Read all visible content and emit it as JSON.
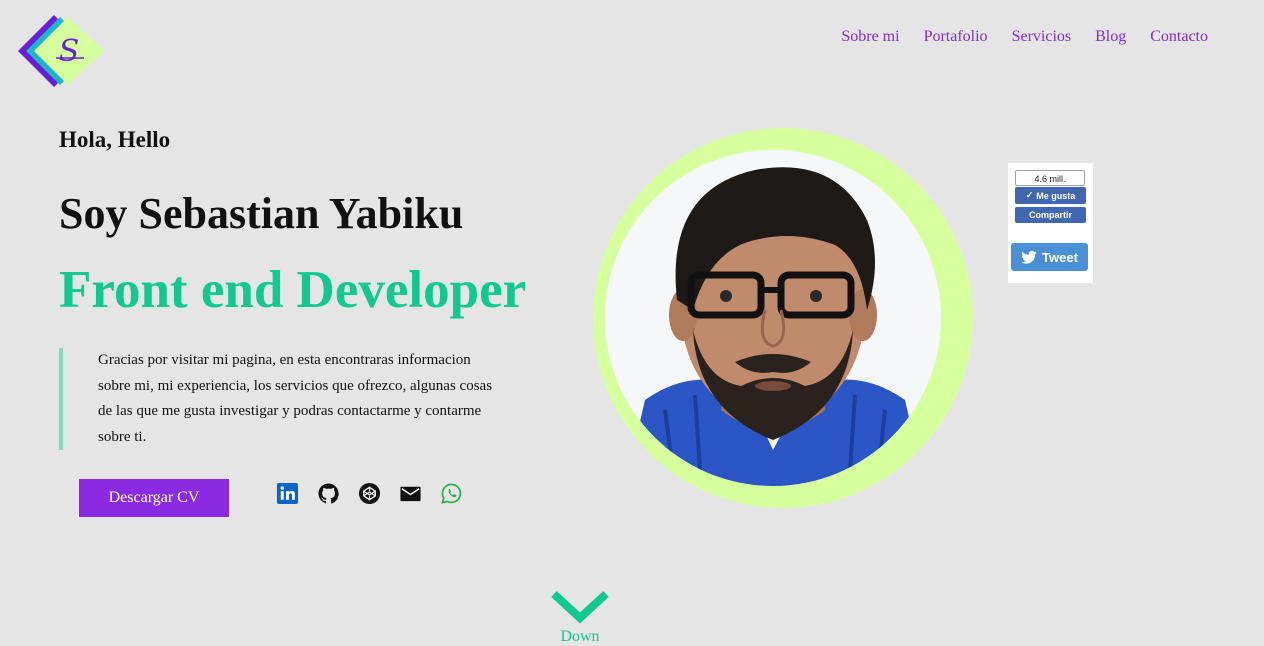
{
  "logo": {
    "letter": "S",
    "colors": {
      "back": "#6a1fd6",
      "mid": "#1fb6c9",
      "front": "#d6ff9e"
    }
  },
  "nav": {
    "items": [
      {
        "label": "Sobre mi"
      },
      {
        "label": "Portafolio"
      },
      {
        "label": "Servicios"
      },
      {
        "label": "Blog"
      },
      {
        "label": "Contacto"
      }
    ]
  },
  "hero": {
    "greeting": "Hola, Hello",
    "name": "Soy Sebastian Yabiku",
    "role": "Front end Developer",
    "intro": "Gracias por visitar mi pagina, en esta encontraras informacion sobre mi, mi experiencia, los servicios que ofrezco, algunas cosas de las que me gusta investigar y podras contactarme y contarme sobre ti.",
    "cv_button": "Descargar CV"
  },
  "socials": [
    {
      "icon": "linkedin-icon"
    },
    {
      "icon": "github-icon"
    },
    {
      "icon": "codepen-icon"
    },
    {
      "icon": "email-icon"
    },
    {
      "icon": "whatsapp-icon"
    }
  ],
  "share": {
    "count": "4.6 mill.",
    "like_label": "Me gusta",
    "share_label": "Compartir",
    "tweet_label": "Tweet"
  },
  "down": {
    "label": "Down"
  },
  "colors": {
    "accent_purple": "#8a2be2",
    "accent_green": "#0fc98f",
    "ring": "#d6ff9e",
    "background": "#e5e5e5"
  }
}
